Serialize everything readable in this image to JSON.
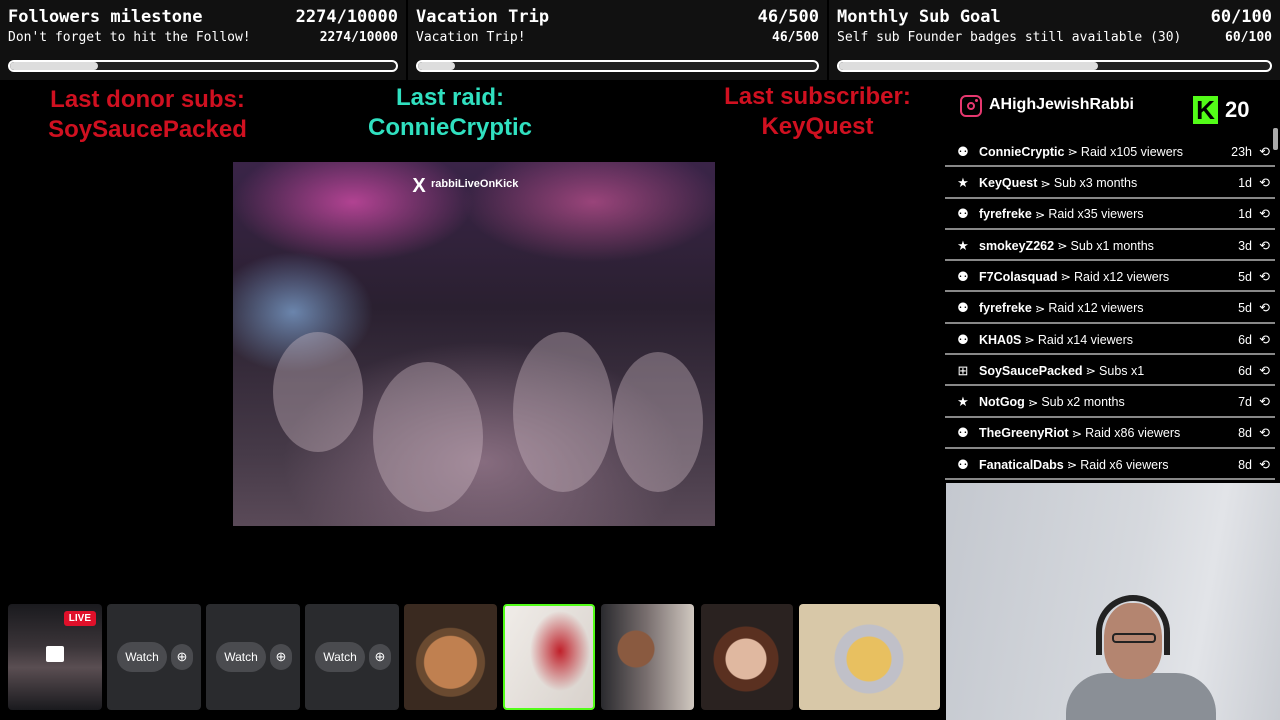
{
  "goals": [
    {
      "title": "Followers milestone",
      "count": "2274/10000",
      "subtitle": "Don't forget to hit the Follow!",
      "count_small": "2274/10000",
      "progress": 0.2274
    },
    {
      "title": "Vacation Trip",
      "count": "46/500",
      "subtitle": "Vacation Trip!",
      "count_small": "46/500",
      "progress": 0.092
    },
    {
      "title": "Monthly Sub Goal",
      "count": "60/100",
      "subtitle": "Self sub Founder badges still available (30)",
      "count_small": "60/100",
      "progress": 0.6
    }
  ],
  "last_donor": {
    "label": "Last donor subs:",
    "name": "SoySaucePacked"
  },
  "last_raid": {
    "label": "Last raid:",
    "name": "ConnieCryptic"
  },
  "last_subscriber": {
    "label": "Last subscriber:",
    "name": "KeyQuest"
  },
  "clip": {
    "watermark_x": "X",
    "watermark_handle": "rabbiLiveOnKick"
  },
  "profile": {
    "username": "AHighJewishRabbi",
    "kick_logo": "K",
    "kick_count": "20",
    "icon": "instagram-icon"
  },
  "events": [
    {
      "name": "ConnieCryptic",
      "sep": "⋗",
      "text": "Raid x105 viewers",
      "time": "23h",
      "icon": "raid-icon"
    },
    {
      "name": "KeyQuest",
      "sep": "⋗",
      "text": "Sub x3 months",
      "time": "1d",
      "icon": "star-icon"
    },
    {
      "name": "fyrefreke",
      "sep": "⋗",
      "text": "Raid x35 viewers",
      "time": "1d",
      "icon": "raid-icon"
    },
    {
      "name": "smokeyZ262",
      "sep": "⋗",
      "text": "Sub x1 months",
      "time": "3d",
      "icon": "star-icon"
    },
    {
      "name": "F7Colasquad",
      "sep": "⋗",
      "text": "Raid x12 viewers",
      "time": "5d",
      "icon": "raid-icon"
    },
    {
      "name": "fyrefreke",
      "sep": "⋗",
      "text": "Raid x12 viewers",
      "time": "5d",
      "icon": "raid-icon"
    },
    {
      "name": "KHA0S",
      "sep": "⋗",
      "text": "Raid x14 viewers",
      "time": "6d",
      "icon": "raid-icon"
    },
    {
      "name": "SoySaucePacked",
      "sep": "⋗",
      "text": "Subs x1",
      "time": "6d",
      "icon": "gift-icon"
    },
    {
      "name": "NotGog",
      "sep": "⋗",
      "text": "Sub x2 months",
      "time": "7d",
      "icon": "star-icon"
    },
    {
      "name": "TheGreenyRiot",
      "sep": "⋗",
      "text": "Raid x86 viewers",
      "time": "8d",
      "icon": "raid-icon"
    },
    {
      "name": "FanaticalDabs",
      "sep": "⋗",
      "text": "Raid x6 viewers",
      "time": "8d",
      "icon": "raid-icon"
    }
  ],
  "thumbnails": {
    "live_badge": "LIVE",
    "watch_label": "Watch",
    "zoom_icon": "zoom-in-icon"
  },
  "colors": {
    "red": "#d01020",
    "cyan": "#30e0c0",
    "kick_green": "#53fc18"
  }
}
